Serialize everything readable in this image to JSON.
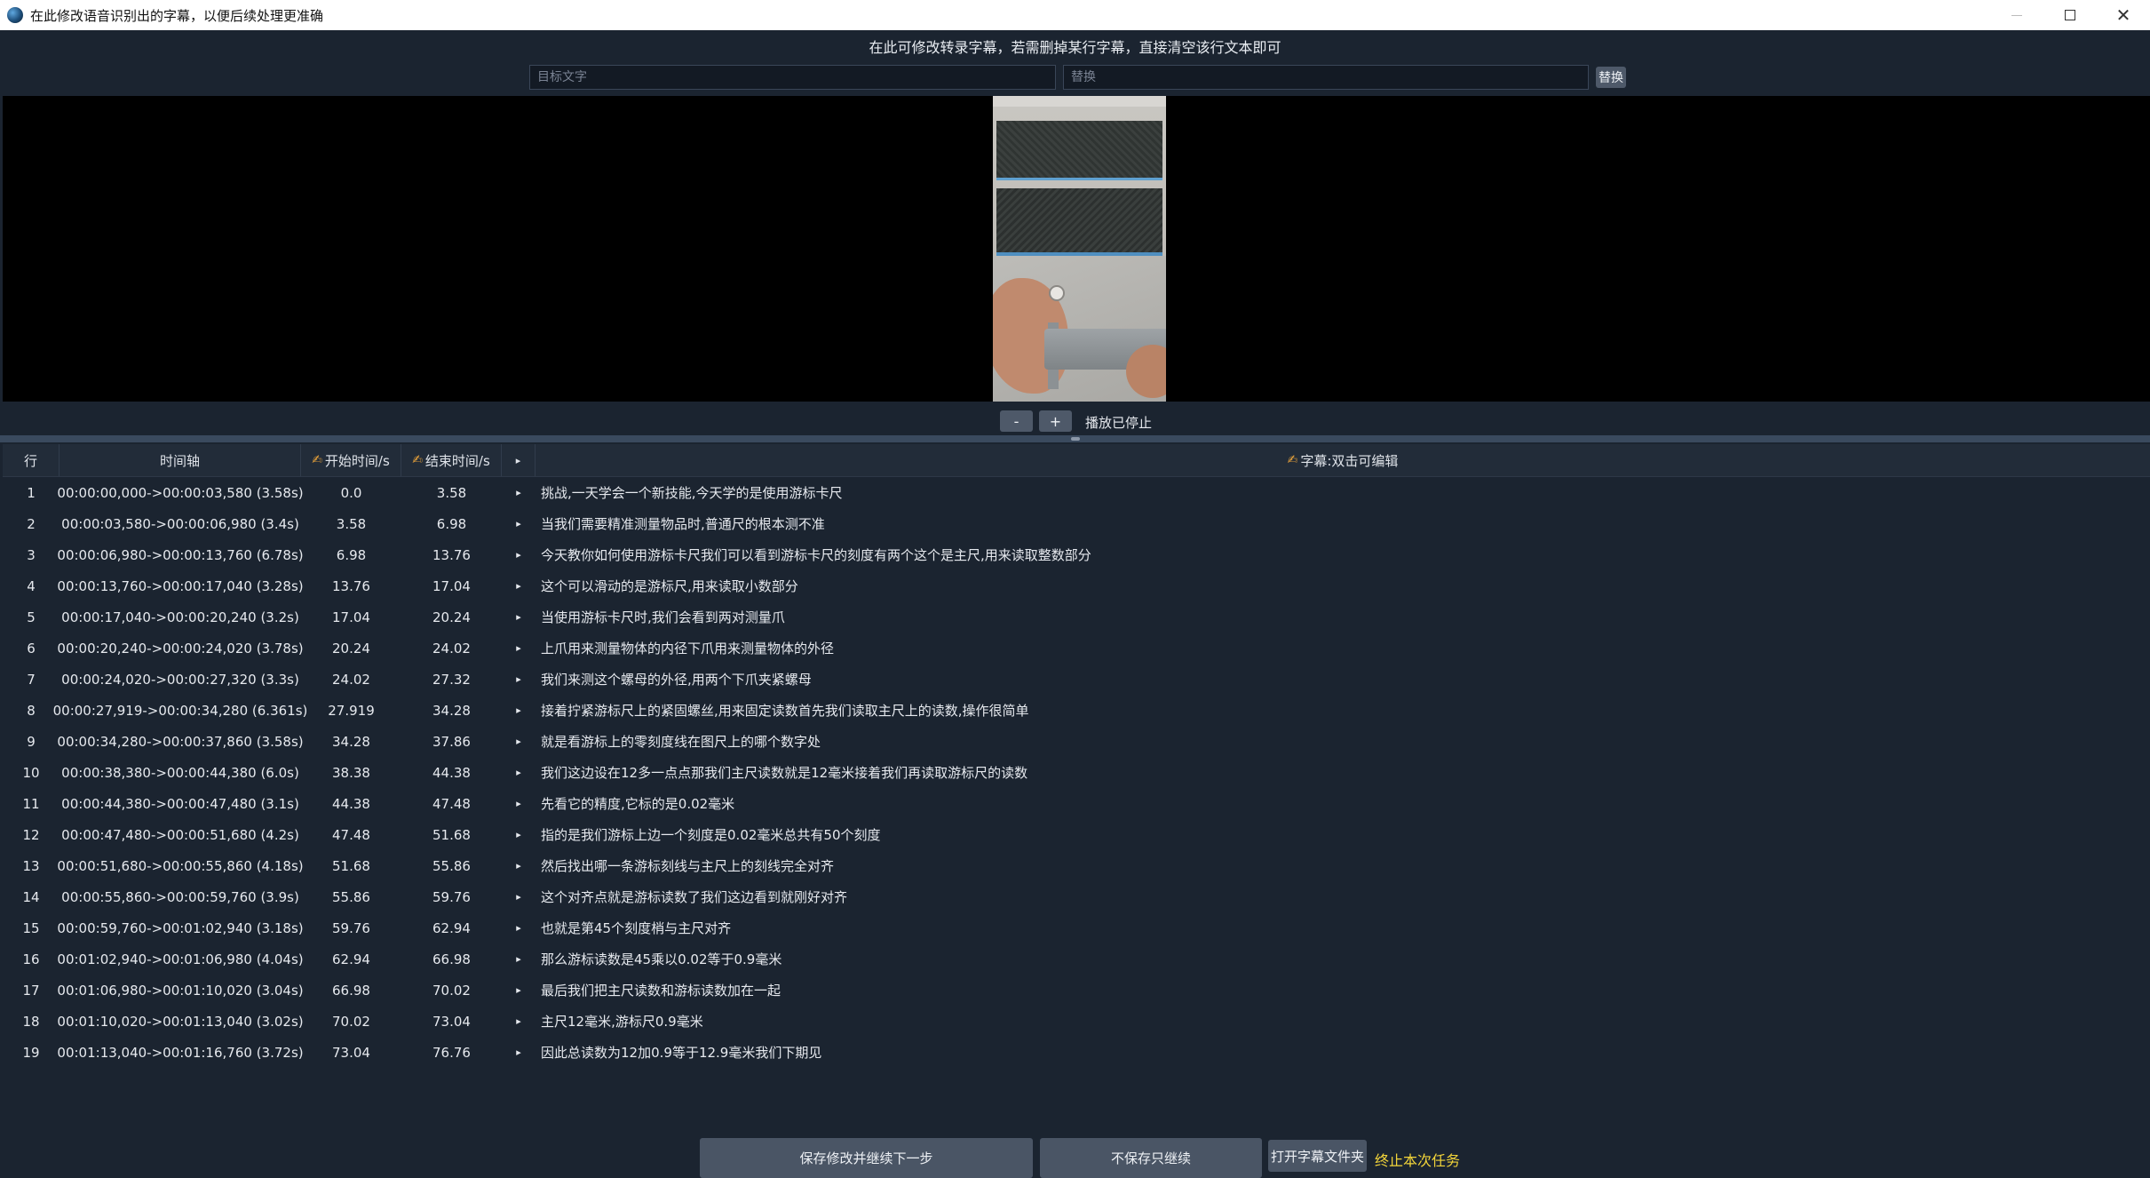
{
  "window": {
    "title": "在此修改语音识别出的字幕，以便后续处理更准确",
    "close_glyph": "✕"
  },
  "hint": "在此可修改转录字幕，若需删掉某行字幕，直接清空该行文本即可",
  "search": {
    "target_placeholder": "目标文字",
    "replace_placeholder": "替换",
    "replace_button": "替换"
  },
  "playback": {
    "minus_label": "-",
    "plus_label": "+",
    "status": "播放已停止"
  },
  "table": {
    "headers": {
      "row": "行",
      "timeline": "时间轴",
      "start": "开始时间/s",
      "end": "结束时间/s",
      "play": "▸",
      "text": "字幕:双击可编辑"
    },
    "rows": [
      {
        "no": "1",
        "timeline": "00:00:00,000->00:00:03,580 (3.58s)",
        "start": "0.0",
        "end": "3.58",
        "text": "挑战,一天学会一个新技能,今天学的是使用游标卡尺"
      },
      {
        "no": "2",
        "timeline": "00:00:03,580->00:00:06,980 (3.4s)",
        "start": "3.58",
        "end": "6.98",
        "text": "当我们需要精准测量物品时,普通尺的根本测不准"
      },
      {
        "no": "3",
        "timeline": "00:00:06,980->00:00:13,760 (6.78s)",
        "start": "6.98",
        "end": "13.76",
        "text": "今天教你如何使用游标卡尺我们可以看到游标卡尺的刻度有两个这个是主尺,用来读取整数部分"
      },
      {
        "no": "4",
        "timeline": "00:00:13,760->00:00:17,040 (3.28s)",
        "start": "13.76",
        "end": "17.04",
        "text": "这个可以滑动的是游标尺,用来读取小数部分"
      },
      {
        "no": "5",
        "timeline": "00:00:17,040->00:00:20,240 (3.2s)",
        "start": "17.04",
        "end": "20.24",
        "text": "当使用游标卡尺时,我们会看到两对测量爪"
      },
      {
        "no": "6",
        "timeline": "00:00:20,240->00:00:24,020 (3.78s)",
        "start": "20.24",
        "end": "24.02",
        "text": "上爪用来测量物体的内径下爪用来测量物体的外径"
      },
      {
        "no": "7",
        "timeline": "00:00:24,020->00:00:27,320 (3.3s)",
        "start": "24.02",
        "end": "27.32",
        "text": "我们来测这个螺母的外径,用两个下爪夹紧螺母"
      },
      {
        "no": "8",
        "timeline": "00:00:27,919->00:00:34,280 (6.361s)",
        "start": "27.919",
        "end": "34.28",
        "text": "接着拧紧游标尺上的紧固螺丝,用来固定读数首先我们读取主尺上的读数,操作很简单"
      },
      {
        "no": "9",
        "timeline": "00:00:34,280->00:00:37,860 (3.58s)",
        "start": "34.28",
        "end": "37.86",
        "text": "就是看游标上的零刻度线在图尺上的哪个数字处"
      },
      {
        "no": "10",
        "timeline": "00:00:38,380->00:00:44,380 (6.0s)",
        "start": "38.38",
        "end": "44.38",
        "text": "我们这边设在12多一点点那我们主尺读数就是12毫米接着我们再读取游标尺的读数"
      },
      {
        "no": "11",
        "timeline": "00:00:44,380->00:00:47,480 (3.1s)",
        "start": "44.38",
        "end": "47.48",
        "text": "先看它的精度,它标的是0.02毫米"
      },
      {
        "no": "12",
        "timeline": "00:00:47,480->00:00:51,680 (4.2s)",
        "start": "47.48",
        "end": "51.68",
        "text": "指的是我们游标上边一个刻度是0.02毫米总共有50个刻度"
      },
      {
        "no": "13",
        "timeline": "00:00:51,680->00:00:55,860 (4.18s)",
        "start": "51.68",
        "end": "55.86",
        "text": "然后找出哪一条游标刻线与主尺上的刻线完全对齐"
      },
      {
        "no": "14",
        "timeline": "00:00:55,860->00:00:59,760 (3.9s)",
        "start": "55.86",
        "end": "59.76",
        "text": "这个对齐点就是游标读数了我们这边看到就刚好对齐"
      },
      {
        "no": "15",
        "timeline": "00:00:59,760->00:01:02,940 (3.18s)",
        "start": "59.76",
        "end": "62.94",
        "text": "也就是第45个刻度梢与主尺对齐"
      },
      {
        "no": "16",
        "timeline": "00:01:02,940->00:01:06,980 (4.04s)",
        "start": "62.94",
        "end": "66.98",
        "text": "那么游标读数是45乘以0.02等于0.9毫米"
      },
      {
        "no": "17",
        "timeline": "00:01:06,980->00:01:10,020 (3.04s)",
        "start": "66.98",
        "end": "70.02",
        "text": "最后我们把主尺读数和游标读数加在一起"
      },
      {
        "no": "18",
        "timeline": "00:01:10,020->00:01:13,040 (3.02s)",
        "start": "70.02",
        "end": "73.04",
        "text": "主尺12毫米,游标尺0.9毫米"
      },
      {
        "no": "19",
        "timeline": "00:01:13,040->00:01:16,760 (3.72s)",
        "start": "73.04",
        "end": "76.76",
        "text": "因此总读数为12加0.9等于12.9毫米我们下期见"
      }
    ]
  },
  "footer": {
    "save_continue": "保存修改并继续下一步",
    "continue_no_save": "不保存只继续",
    "open_folder": "打开字幕文件夹",
    "stop_task": "终止本次任务"
  },
  "colors": {
    "background": "#1b2430",
    "button": "#4e5969",
    "stop_link": "#f2d43a",
    "edit_icon": "#e8a23a"
  },
  "icons": {
    "edit": "pencil-hand-icon",
    "play": "play-triangle-icon"
  }
}
